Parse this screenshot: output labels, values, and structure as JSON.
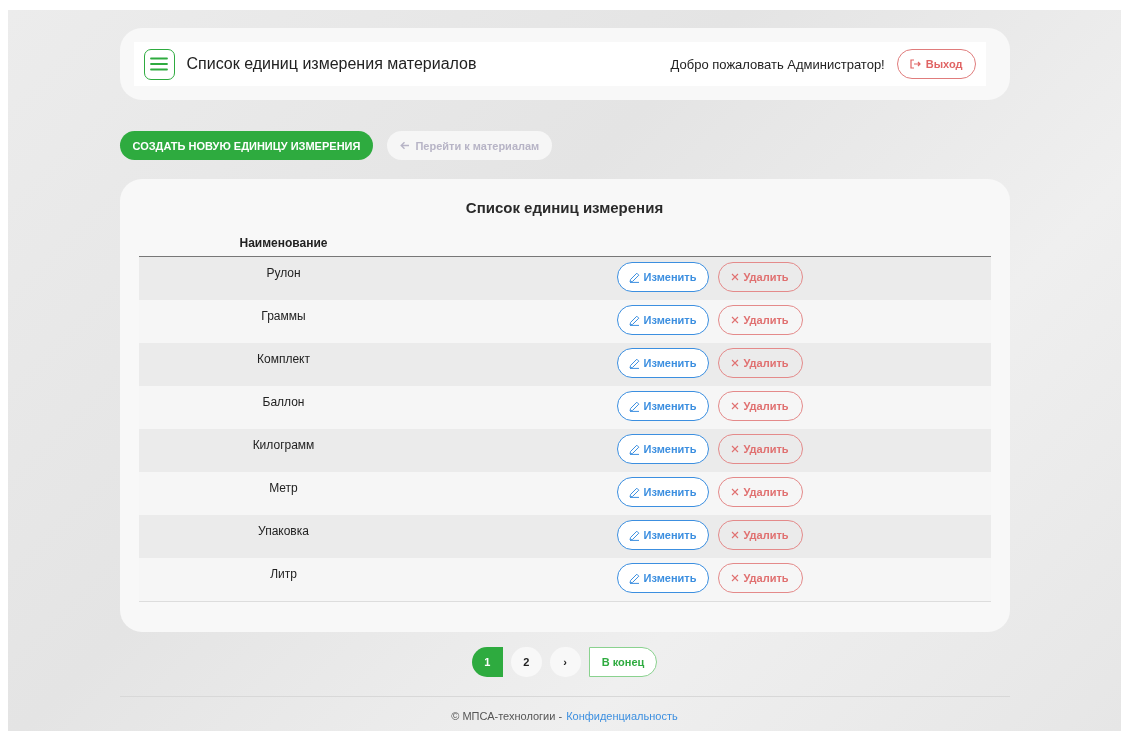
{
  "header": {
    "title": "Список единиц измерения материалов",
    "welcome": "Добро пожаловать Администратор!",
    "logout": "Выход"
  },
  "actions": [
    {
      "label": "СОЗДАТЬ НОВУЮ ЕДИНИЦУ ИЗМЕРЕНИЯ",
      "kind": "primary"
    },
    {
      "label": "Перейти к материалам",
      "kind": "back"
    }
  ],
  "table": {
    "title": "Список единиц измерения",
    "columns": [
      "Наименование"
    ],
    "rows": [
      {
        "name": "Рулон",
        "edit": "Изменить",
        "delete": "Удалить"
      },
      {
        "name": "Граммы",
        "edit": "Изменить",
        "delete": "Удалить"
      },
      {
        "name": "Комплект",
        "edit": "Изменить",
        "delete": "Удалить"
      },
      {
        "name": "Баллон",
        "edit": "Изменить",
        "delete": "Удалить"
      },
      {
        "name": "Килограмм",
        "edit": "Изменить",
        "delete": "Удалить"
      },
      {
        "name": "Метр",
        "edit": "Изменить",
        "delete": "Удалить"
      },
      {
        "name": "Упаковка",
        "edit": "Изменить",
        "delete": "Удалить"
      },
      {
        "name": "Литр",
        "edit": "Изменить",
        "delete": "Удалить"
      }
    ]
  },
  "pagination": {
    "pages": [
      {
        "label": "1",
        "selected": true
      },
      {
        "label": "2",
        "selected": false
      }
    ],
    "next": "›",
    "last": "В конец"
  },
  "footer": {
    "copyright": "© МПСА-технологии -",
    "link": "Конфиденциальность"
  }
}
